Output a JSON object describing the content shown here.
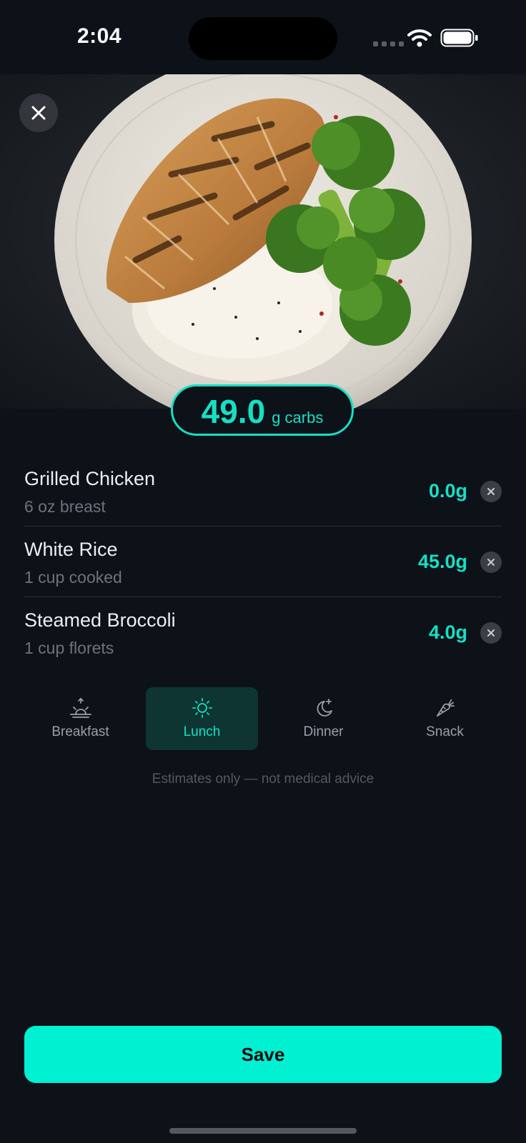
{
  "status_bar": {
    "time": "2:04"
  },
  "hero": {
    "photo_icon": "plate-chicken-rice-broccoli-photo"
  },
  "carbs": {
    "total": "49.0",
    "unit": "g carbs"
  },
  "foods": [
    {
      "name": "Grilled Chicken",
      "portion": "6 oz breast",
      "carbs": "0.0g"
    },
    {
      "name": "White Rice",
      "portion": "1 cup cooked",
      "carbs": "45.0g"
    },
    {
      "name": "Steamed Broccoli",
      "portion": "1 cup florets",
      "carbs": "4.0g"
    }
  ],
  "meals": {
    "selected": "Lunch",
    "options": [
      {
        "label": "Breakfast",
        "icon": "sunrise-icon"
      },
      {
        "label": "Lunch",
        "icon": "sun-icon"
      },
      {
        "label": "Dinner",
        "icon": "moon-stars-icon"
      },
      {
        "label": "Snack",
        "icon": "carrot-icon"
      }
    ]
  },
  "disclaimer": "Estimates only — not medical advice",
  "save_label": "Save",
  "colors": {
    "accent": "#14e0c6",
    "button": "#00f0d2",
    "background": "#0d1118",
    "selected_bg": "#0f3533"
  }
}
